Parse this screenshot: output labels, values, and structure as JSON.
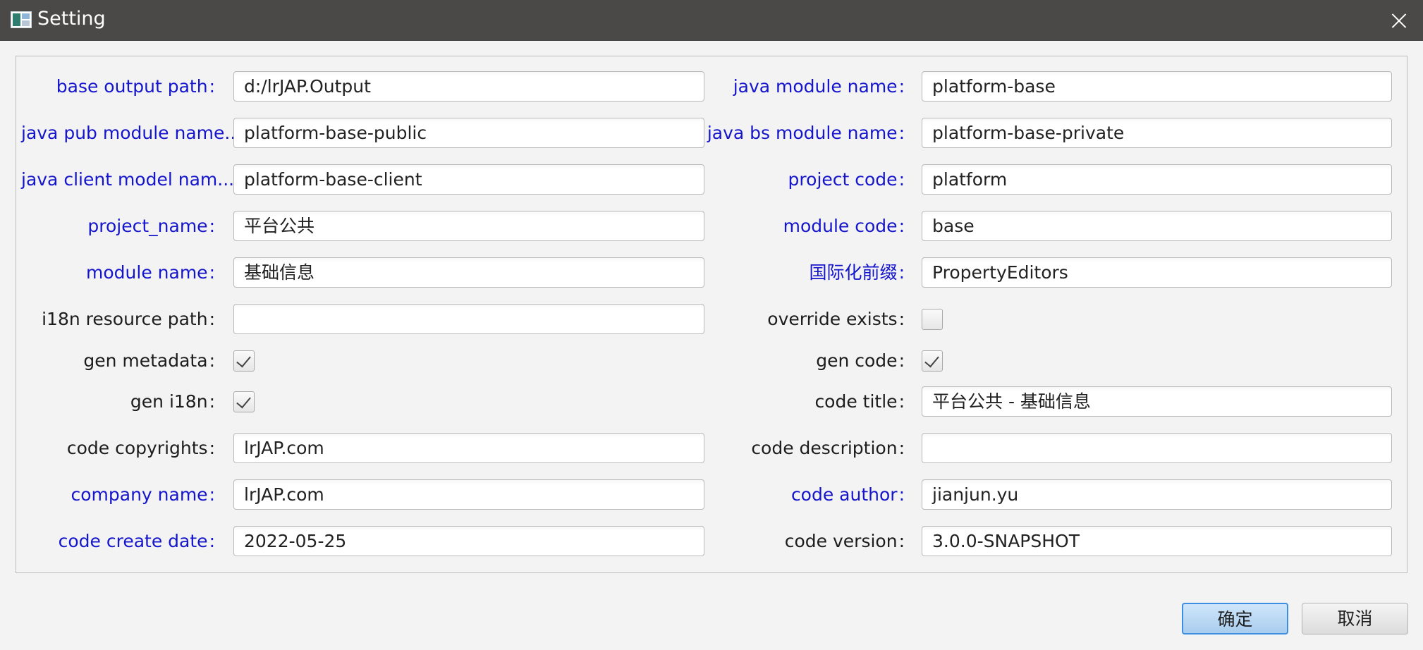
{
  "window": {
    "title": "Setting"
  },
  "left_fields": [
    {
      "label": "base output path",
      "value": "d:/lrJAP.Output",
      "color": "#1515cc"
    },
    {
      "label": "java pub module name...",
      "value": "platform-base-public",
      "color": "#1515cc"
    },
    {
      "label": "java client model nam...",
      "value": "platform-base-client",
      "color": "#1515cc"
    },
    {
      "label": "project_name",
      "value": "平台公共",
      "color": "#1515cc"
    },
    {
      "label": "module name",
      "value": "基础信息",
      "color": "#1515cc"
    },
    {
      "label": "i18n resource path",
      "value": "",
      "color": "#1d1d1d"
    },
    {
      "label": "gen metadata",
      "checked": true
    },
    {
      "label": "gen i18n",
      "checked": true
    },
    {
      "label": "code copyrights",
      "value": "lrJAP.com",
      "color": "#1d1d1d"
    },
    {
      "label": "company name",
      "value": "lrJAP.com",
      "color": "#1515cc"
    },
    {
      "label": "code create date",
      "value": "2022-05-25",
      "color": "#1515cc"
    }
  ],
  "right_fields": [
    {
      "label": "java module name",
      "value": "platform-base",
      "color": "#1515cc"
    },
    {
      "label": "java bs module name",
      "value": "platform-base-private",
      "color": "#1515cc"
    },
    {
      "label": "project code",
      "value": "platform",
      "color": "#1515cc"
    },
    {
      "label": "module code",
      "value": "base",
      "color": "#1515cc"
    },
    {
      "label": "国际化前缀",
      "value": "PropertyEditors",
      "color": "#1515cc"
    },
    {
      "label": "override exists",
      "checked": false
    },
    {
      "label": "gen code",
      "checked": true
    },
    {
      "label": "code title",
      "value": "平台公共 - 基础信息",
      "color": "#1d1d1d"
    },
    {
      "label": "code description",
      "value": "",
      "color": "#1d1d1d"
    },
    {
      "label": "code author",
      "value": "jianjun.yu",
      "color": "#1515cc"
    },
    {
      "label": "code version",
      "value": "3.0.0-SNAPSHOT",
      "color": "#1d1d1d"
    }
  ],
  "colon": ":",
  "buttons": {
    "ok": "确定",
    "cancel": "取消"
  }
}
